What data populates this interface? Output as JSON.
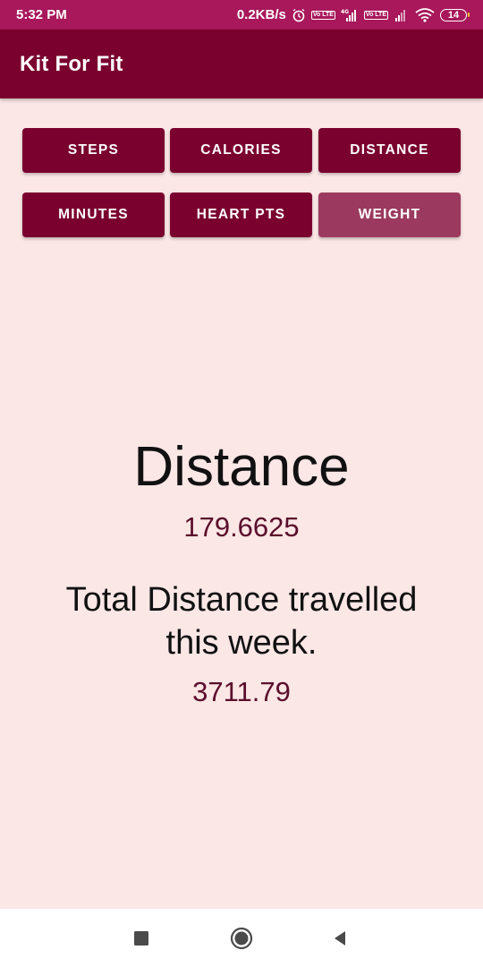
{
  "status_bar": {
    "time": "5:32 PM",
    "network_speed": "0.2KB/s",
    "battery_level": "14",
    "icons": [
      "alarm-icon",
      "volte-icon",
      "signal-4g-icon",
      "volte-icon",
      "signal-icon",
      "wifi-icon",
      "battery-icon"
    ],
    "lte_badge": "Vo LTE",
    "network_type": "4G"
  },
  "app_bar": {
    "title": "Kit For Fit"
  },
  "buttons": {
    "steps": "STEPS",
    "calories": "CALORIES",
    "distance": "DISTANCE",
    "minutes": "MINUTES",
    "heart_pts": "HEART PTS",
    "weight": "WEIGHT"
  },
  "metric": {
    "title": "Distance",
    "value": "179.6625",
    "week_label": "Total Distance travelled this week.",
    "week_value": "3711.79"
  },
  "colors": {
    "status_bar": "#a8185b",
    "app_bar": "#7a002e",
    "background": "#fbe7e6",
    "button": "#7a002e",
    "button_active": "#9b3a5e",
    "value_text": "#5a0e2a"
  },
  "nav_bar": {
    "icons": [
      "recent-apps-icon",
      "home-icon",
      "back-icon"
    ]
  }
}
